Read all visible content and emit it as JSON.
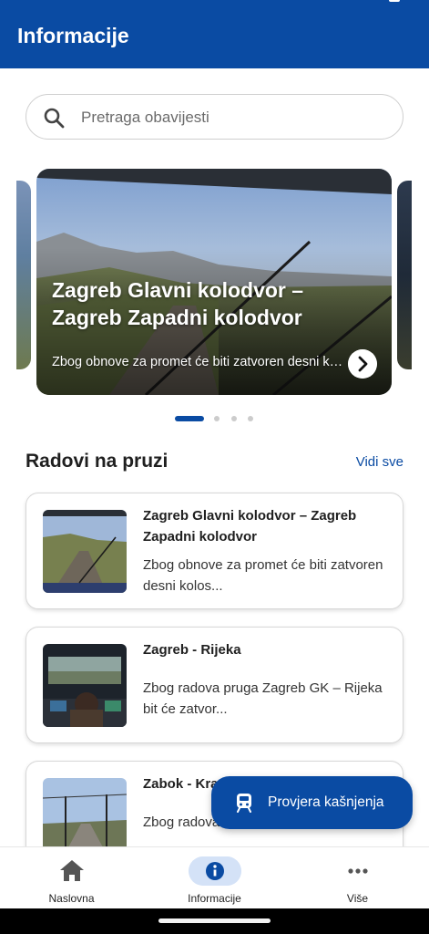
{
  "app_bar": {
    "title": "Informacije"
  },
  "search": {
    "placeholder": "Pretraga obavijesti",
    "icon": "search-icon"
  },
  "carousel": {
    "slide": {
      "title": "Zagreb Glavni kolodvor – Zagreb Zapadni kolodvor",
      "text": "Zbog obnove za promet će biti zatvoren desni ko..."
    },
    "page_count": 4,
    "active_page": 1
  },
  "works": {
    "title": "Radovi na pruzi",
    "see_all": "Vidi sve",
    "items": [
      {
        "title": "Zagreb Glavni kolodvor – Zagreb Zapadni kolodvor",
        "text": "Zbog obnove za promet će biti zatvoren desni kolos..."
      },
      {
        "title": "Zagreb - Rijeka",
        "text": "Zbog radova pruga Zagreb GK – Rijeka bit će zatvor..."
      },
      {
        "title": "Zabok - Kra",
        "text": "Zbog radova … Zabok – Đurmanec –"
      }
    ]
  },
  "fab": {
    "label": "Provjera kašnjenja",
    "icon": "train-icon"
  },
  "bottom_nav": {
    "items": [
      {
        "label": "Naslovna",
        "icon": "home-icon"
      },
      {
        "label": "Informacije",
        "icon": "info-icon"
      },
      {
        "label": "Više",
        "icon": "more-icon"
      }
    ],
    "active": "Informacije"
  },
  "colors": {
    "primary": "#0a4ba3",
    "nav_active_bg": "#d4e2f7"
  }
}
